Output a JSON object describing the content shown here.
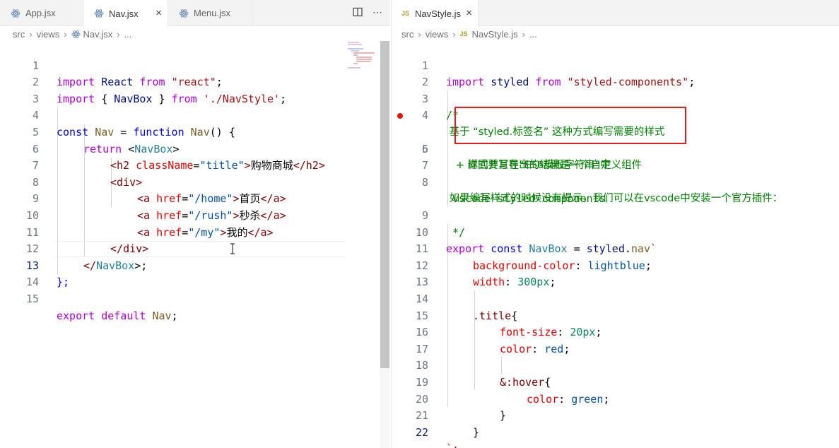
{
  "left": {
    "tabs": [
      {
        "label": "App.jsx",
        "icon": "react-icon",
        "active": false
      },
      {
        "label": "Nav.jsx",
        "icon": "react-icon",
        "active": true
      },
      {
        "label": "Menu.jsx",
        "icon": "react-icon",
        "active": false
      }
    ],
    "close_glyph": "×",
    "actions": {
      "split": "split-editor-icon",
      "more": "⋯"
    },
    "breadcrumb": {
      "folder1": "src",
      "folder2": "views",
      "file": "Nav.jsx",
      "more": "..."
    },
    "lines": [
      {
        "n": "1"
      },
      {
        "n": "2"
      },
      {
        "n": "3"
      },
      {
        "n": "4"
      },
      {
        "n": "5"
      },
      {
        "n": "6"
      },
      {
        "n": "7"
      },
      {
        "n": "8"
      },
      {
        "n": "9"
      },
      {
        "n": "10"
      },
      {
        "n": "11"
      },
      {
        "n": "12"
      },
      {
        "n": "13"
      },
      {
        "n": "14"
      },
      {
        "n": "15"
      }
    ],
    "code": {
      "l1": {
        "a": "import",
        "b": " React ",
        "c": "from",
        "d": " ",
        "e": "\"react\"",
        "f": ";"
      },
      "l2": {
        "a": "import",
        "b": " { ",
        "c": "NavBox",
        "d": " } ",
        "e": "from",
        "f": " ",
        "g": "'./NavStyle'",
        "h": ";"
      },
      "l4": {
        "a": "const",
        "b": " ",
        "c": "Nav",
        "d": " = ",
        "e": "function",
        "f": " ",
        "g": "Nav",
        "h": "() {"
      },
      "l5": {
        "a": "return",
        "b": " <",
        "c": "NavBox",
        "d": ">"
      },
      "l6": {
        "a": "<",
        "b": "h2",
        "c": " ",
        "d": "className",
        "e": "=",
        "f": "\"title\"",
        "g": ">",
        "h": "购物商城",
        "i": "</",
        "j": "h2",
        "k": ">"
      },
      "l7": {
        "a": "<",
        "b": "div",
        "c": ">"
      },
      "l8": {
        "a": "<",
        "b": "a",
        "c": " ",
        "d": "href",
        "e": "=",
        "f": "\"/home\"",
        "g": ">",
        "h": "首页",
        "i": "</",
        "j": "a",
        "k": ">"
      },
      "l9": {
        "a": "<",
        "b": "a",
        "c": " ",
        "d": "href",
        "e": "=",
        "f": "\"/rush\"",
        "g": ">",
        "h": "秒杀",
        "i": "</",
        "j": "a",
        "k": ">"
      },
      "l10": {
        "a": "<",
        "b": "a",
        "c": " ",
        "d": "href",
        "e": "=",
        "f": "\"/my\"",
        "g": ">",
        "h": "我的",
        "i": "</",
        "j": "a",
        "k": ">"
      },
      "l11": {
        "a": "</",
        "b": "div",
        "c": ">"
      },
      "l12": {
        "a": "</",
        "b": "NavBox",
        "c": ">;"
      },
      "l13": {
        "a": "};"
      },
      "l15": {
        "a": "export",
        "b": " ",
        "c": "default",
        "d": " ",
        "e": "Nav",
        "f": ";"
      }
    },
    "current_line": "13"
  },
  "right": {
    "tab": {
      "label": "NavStyle.js",
      "icon_text": "JS",
      "active": true
    },
    "close_glyph": "×",
    "breadcrumb": {
      "folder1": "src",
      "folder2": "views",
      "icon_text": "JS",
      "file": "NavStyle.js",
      "more": "..."
    },
    "lines": {
      "n1": "1",
      "n2": "2",
      "n3": "3",
      "n4": "4",
      "n5": "5",
      "n6": "6",
      "n7": "7",
      "n8": "8",
      "n9": "9",
      "n10": "10",
      "n11": "11",
      "n12": "12",
      "n13": "13",
      "n14": "14",
      "n15": "15",
      "n16": "16",
      "n17": "17",
      "n18": "18",
      "n19": "19",
      "n20": "20",
      "n21": "21",
      "n22": "22"
    },
    "code": {
      "l1": {
        "a": "import",
        "b": " styled ",
        "c": "from",
        "d": " ",
        "e": "\"styled-components\"",
        "f": ";"
      },
      "l3": "/*",
      "l4": " 基于 “styled.标签名” 这种方式编写需要的样式",
      "l5": "   + 样式要写在“ES6模板字符串”中",
      "l6": "   + 返回并且导出的结果是一个自定义组件",
      "l8a": " 如果编写样式的时候没有提示，我们可以在vscode中安装一个官方插件：",
      "l8b": " vscode-styled-components",
      "l9": " */",
      "l10": {
        "a": "export",
        "b": " ",
        "c": "const",
        "d": " ",
        "e": "NavBox",
        "f": " = ",
        "g": "styled",
        "h": ".",
        "i": "nav",
        "j": "`"
      },
      "l11": {
        "a": "background-color",
        "b": ": ",
        "c": "lightblue",
        "d": ";"
      },
      "l12": {
        "a": "width",
        "b": ": ",
        "c": "300px",
        "d": ";"
      },
      "l14": {
        "a": ".title",
        "b": "{"
      },
      "l15": {
        "a": "font-size",
        "b": ": ",
        "c": "20px",
        "d": ";"
      },
      "l16": {
        "a": "color",
        "b": ": ",
        "c": "red",
        "d": ";"
      },
      "l18": {
        "a": "&:hover",
        "b": "{"
      },
      "l19": {
        "a": "color",
        "b": ": ",
        "c": "green",
        "d": ";"
      },
      "l20": "}",
      "l21": "}",
      "l22": "`;"
    },
    "current_line": "22"
  },
  "colors": {
    "accent_red": "#e21b1b",
    "breakpoint": "#e51400"
  }
}
